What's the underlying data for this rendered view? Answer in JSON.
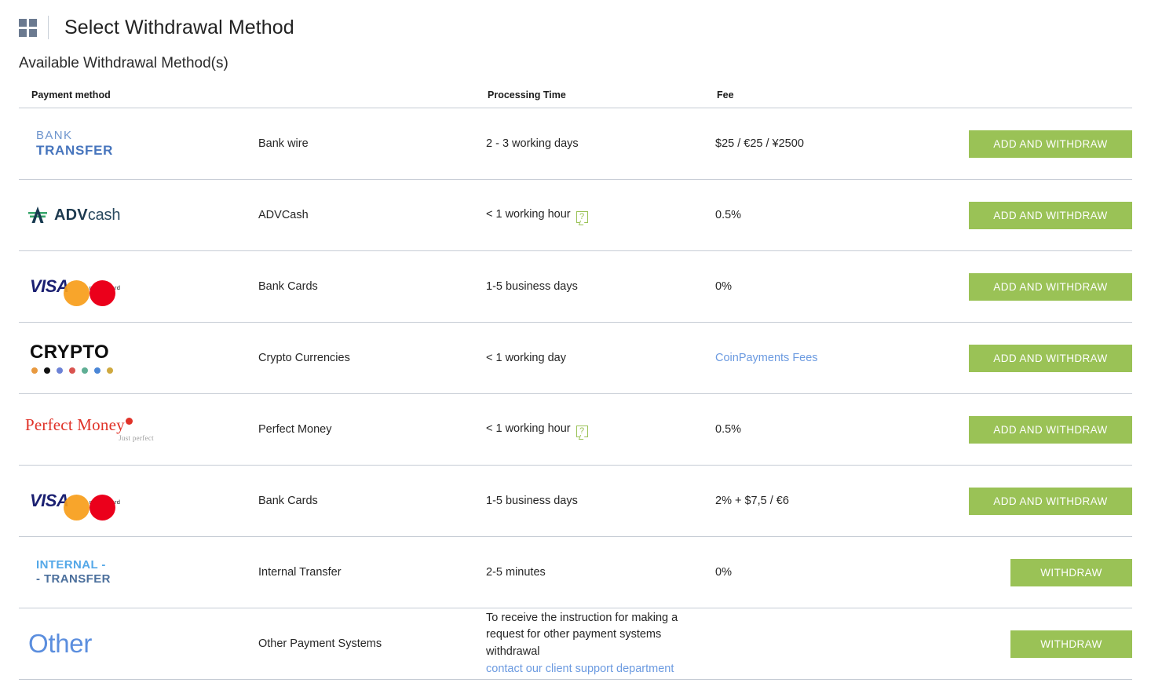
{
  "header": {
    "grid_icon": "grid-icon",
    "title": "Select Withdrawal Method"
  },
  "section": {
    "heading": "Available Withdrawal Method(s)"
  },
  "table": {
    "columns": {
      "payment_method": "Payment method",
      "processing_time": "Processing Time",
      "fee": "Fee",
      "action": ""
    },
    "rows": [
      {
        "logo": {
          "type": "bank-transfer",
          "line1": "BANK",
          "line2": "TRANSFER"
        },
        "name": "Bank wire",
        "time": "2 - 3 working days",
        "time_tip": false,
        "fee": "$25 / €25 / ¥2500",
        "fee_is_link": false,
        "button": "ADD AND WITHDRAW",
        "button_size": "wide"
      },
      {
        "logo": {
          "type": "advcash",
          "bold": "ADV",
          "light": "cash"
        },
        "name": "ADVCash",
        "time": "< 1 working hour",
        "time_tip": true,
        "fee": "0.5%",
        "fee_is_link": false,
        "button": "ADD AND WITHDRAW",
        "button_size": "wide"
      },
      {
        "logo": {
          "type": "cards",
          "visa": "VISA",
          "mastercard": "mastercard"
        },
        "name": "Bank Cards",
        "time": "1-5 business days",
        "time_tip": false,
        "fee": "0%",
        "fee_is_link": false,
        "button": "ADD AND WITHDRAW",
        "button_size": "wide"
      },
      {
        "logo": {
          "type": "crypto",
          "word": "CRYPTO"
        },
        "name": "Crypto Currencies",
        "time": "< 1 working day",
        "time_tip": false,
        "fee": "CoinPayments Fees",
        "fee_is_link": true,
        "button": "ADD AND WITHDRAW",
        "button_size": "wide"
      },
      {
        "logo": {
          "type": "perfect-money",
          "line1": "Perfect Money",
          "line2": "Just perfect"
        },
        "name": "Perfect Money",
        "time": "< 1 working hour",
        "time_tip": true,
        "fee": "0.5%",
        "fee_is_link": false,
        "button": "ADD AND WITHDRAW",
        "button_size": "wide"
      },
      {
        "logo": {
          "type": "cards",
          "visa": "VISA",
          "mastercard": "mastercard"
        },
        "name": "Bank Cards",
        "time": "1-5 business days",
        "time_tip": false,
        "fee": "2% + $7,5 / €6",
        "fee_is_link": false,
        "button": "ADD AND WITHDRAW",
        "button_size": "wide"
      },
      {
        "logo": {
          "type": "internal-transfer",
          "line1": "INTERNAL -",
          "line2": "- TRANSFER"
        },
        "name": "Internal Transfer",
        "time": "2-5 minutes",
        "time_tip": false,
        "fee": "0%",
        "fee_is_link": false,
        "button": "WITHDRAW",
        "button_size": "narrow"
      },
      {
        "logo": {
          "type": "other",
          "word": "Other"
        },
        "name": "Other Payment Systems",
        "time": "To receive the instruction for making a request for other payment systems withdrawal",
        "time_link": "contact our client support department",
        "time_tip": false,
        "fee": "",
        "fee_is_link": false,
        "button": "WITHDRAW",
        "button_size": "narrow"
      }
    ]
  },
  "colors": {
    "button_green": "#9ac256",
    "link_blue": "#6b9ae0",
    "border_gray": "#c6ccd5",
    "bank_blue": "#4775bd",
    "visa_navy": "#1a1f71",
    "mastercard_red": "#eb001b",
    "mastercard_orange": "#f79e1b",
    "perfect_money_red": "#e03228",
    "internal_light_blue": "#54a8e8",
    "internal_dark_blue": "#4b6f9c",
    "other_blue": "#5b8ede",
    "grid_icon_gray": "#6b7a90"
  },
  "crypto_dot_colors": [
    "#e8993f",
    "#111111",
    "#6c82d6",
    "#d9534f",
    "#5fae94",
    "#4a86d6",
    "#cfa93f"
  ]
}
